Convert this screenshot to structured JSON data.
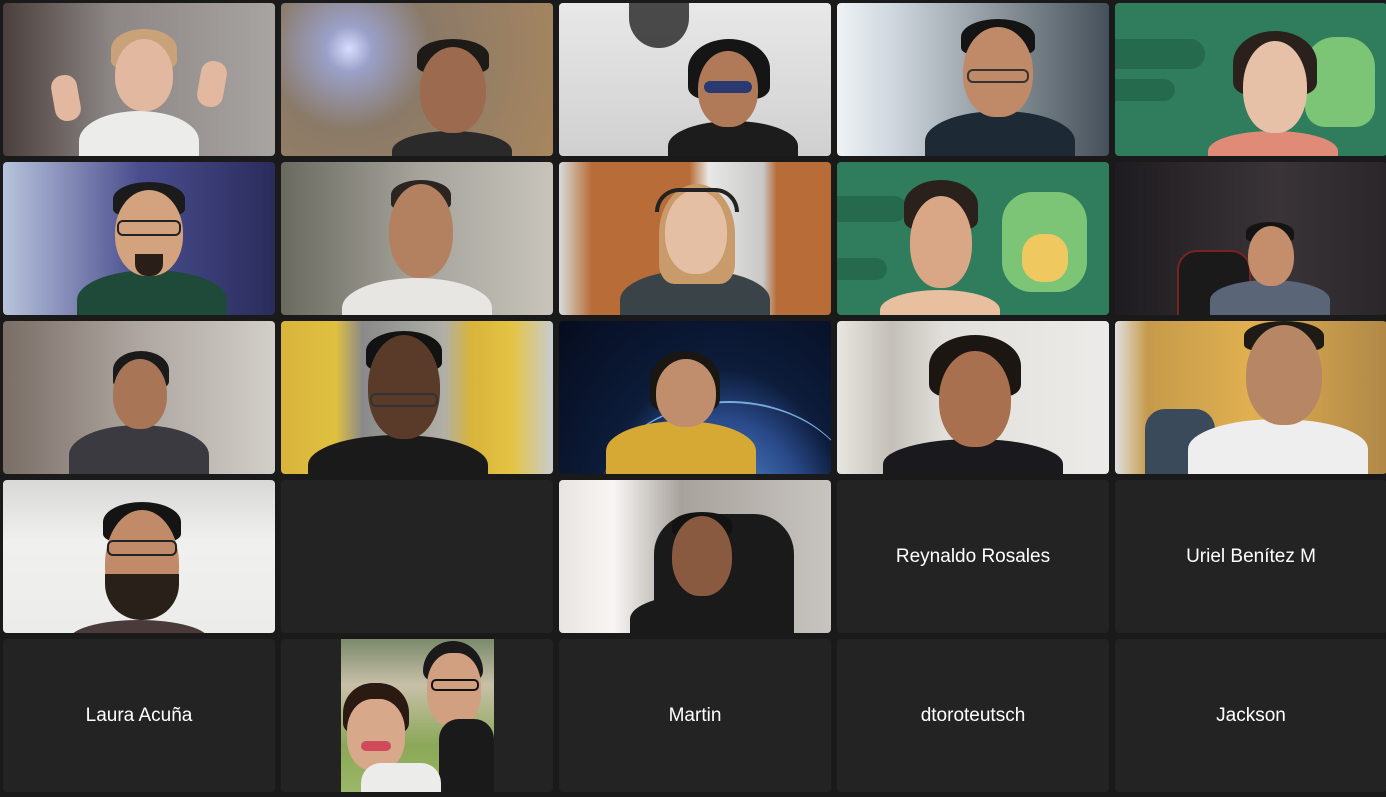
{
  "meeting": {
    "participants": [
      {
        "id": "p1",
        "type": "video",
        "bg": "#6b6563",
        "skin": "#e2b8a0",
        "hair": "#c9a27a",
        "shirt": "#ececea"
      },
      {
        "id": "p2",
        "type": "video",
        "bg": "#a3886a",
        "skin": "#9c6a4e",
        "hair": "#1e1a18",
        "shirt": "#2a2a2a"
      },
      {
        "id": "p3",
        "type": "video",
        "bg": "#dcdcdc",
        "skin": "#b07a58",
        "hair": "#151515",
        "shirt": "#1c1c1c"
      },
      {
        "id": "p4",
        "type": "video",
        "bg": "#b8c2c8",
        "skin": "#c08a68",
        "hair": "#141414",
        "shirt": "#1d2a36"
      },
      {
        "id": "p5",
        "type": "video",
        "bg": "#2f7d5c",
        "skin": "#e6c1a8",
        "hair": "#2a211c",
        "shirt": "#e08a78"
      },
      {
        "id": "p6",
        "type": "video",
        "bg": "#3b3f7a",
        "skin": "#d3a27f",
        "hair": "#1b1b1b",
        "shirt": "#1f4a3a"
      },
      {
        "id": "p7",
        "type": "video",
        "bg": "#8c8880",
        "skin": "#b38060",
        "hair": "#2b2420",
        "shirt": "#e8e6e2"
      },
      {
        "id": "p8",
        "type": "video",
        "bg": "#b86d38",
        "skin": "#e5bfa3",
        "hair": "#c99a6a",
        "shirt": "#3a4448"
      },
      {
        "id": "p9",
        "type": "video",
        "bg": "#2f7d5c",
        "skin": "#d9a785",
        "hair": "#2a211c",
        "shirt": "#e8c0a0"
      },
      {
        "id": "p10",
        "type": "video",
        "bg": "#2d2a2e",
        "skin": "#c48e6c",
        "hair": "#141414",
        "shirt": "#5a6678"
      },
      {
        "id": "p11",
        "type": "video",
        "bg": "#a09890",
        "skin": "#a87656",
        "hair": "#1a1a1a",
        "shirt": "#3a3a40"
      },
      {
        "id": "p12",
        "type": "video",
        "bg": "#d8b43a",
        "skin": "#5a3a28",
        "hair": "#121212",
        "shirt": "#1a1a1a"
      },
      {
        "id": "p13",
        "type": "video",
        "bg": "#0c1c3a",
        "skin": "#c08e6c",
        "hair": "#1a1612",
        "shirt": "#d6a834"
      },
      {
        "id": "p14",
        "type": "video",
        "bg": "#d4d2cc",
        "skin": "#a8704e",
        "hair": "#1b1612",
        "shirt": "#1a1a1e"
      },
      {
        "id": "p15",
        "type": "video",
        "bg": "#c69a4a",
        "skin": "#b78664",
        "hair": "#1e1a16",
        "shirt": "#eeeeee"
      },
      {
        "id": "p16",
        "type": "video",
        "bg": "#ececea",
        "skin": "#c18a68",
        "hair": "#141414",
        "shirt": "#4a3a3a"
      },
      {
        "id": "p17",
        "type": "blank"
      },
      {
        "id": "p18",
        "type": "video",
        "bg": "#cfc8c0",
        "skin": "#8a5a40",
        "hair": "#121212",
        "shirt": "#1a1a1a"
      },
      {
        "id": "p19",
        "type": "name",
        "name": "Reynaldo Rosales"
      },
      {
        "id": "p20",
        "type": "name",
        "name": "Uriel Benítez M"
      },
      {
        "id": "p21",
        "type": "name",
        "name": "Laura Acuña"
      },
      {
        "id": "p22",
        "type": "avatar"
      },
      {
        "id": "p23",
        "type": "name",
        "name": "Martin"
      },
      {
        "id": "p24",
        "type": "name",
        "name": "dtoroteutsch"
      },
      {
        "id": "p25",
        "type": "name",
        "name": "Jackson"
      }
    ]
  }
}
